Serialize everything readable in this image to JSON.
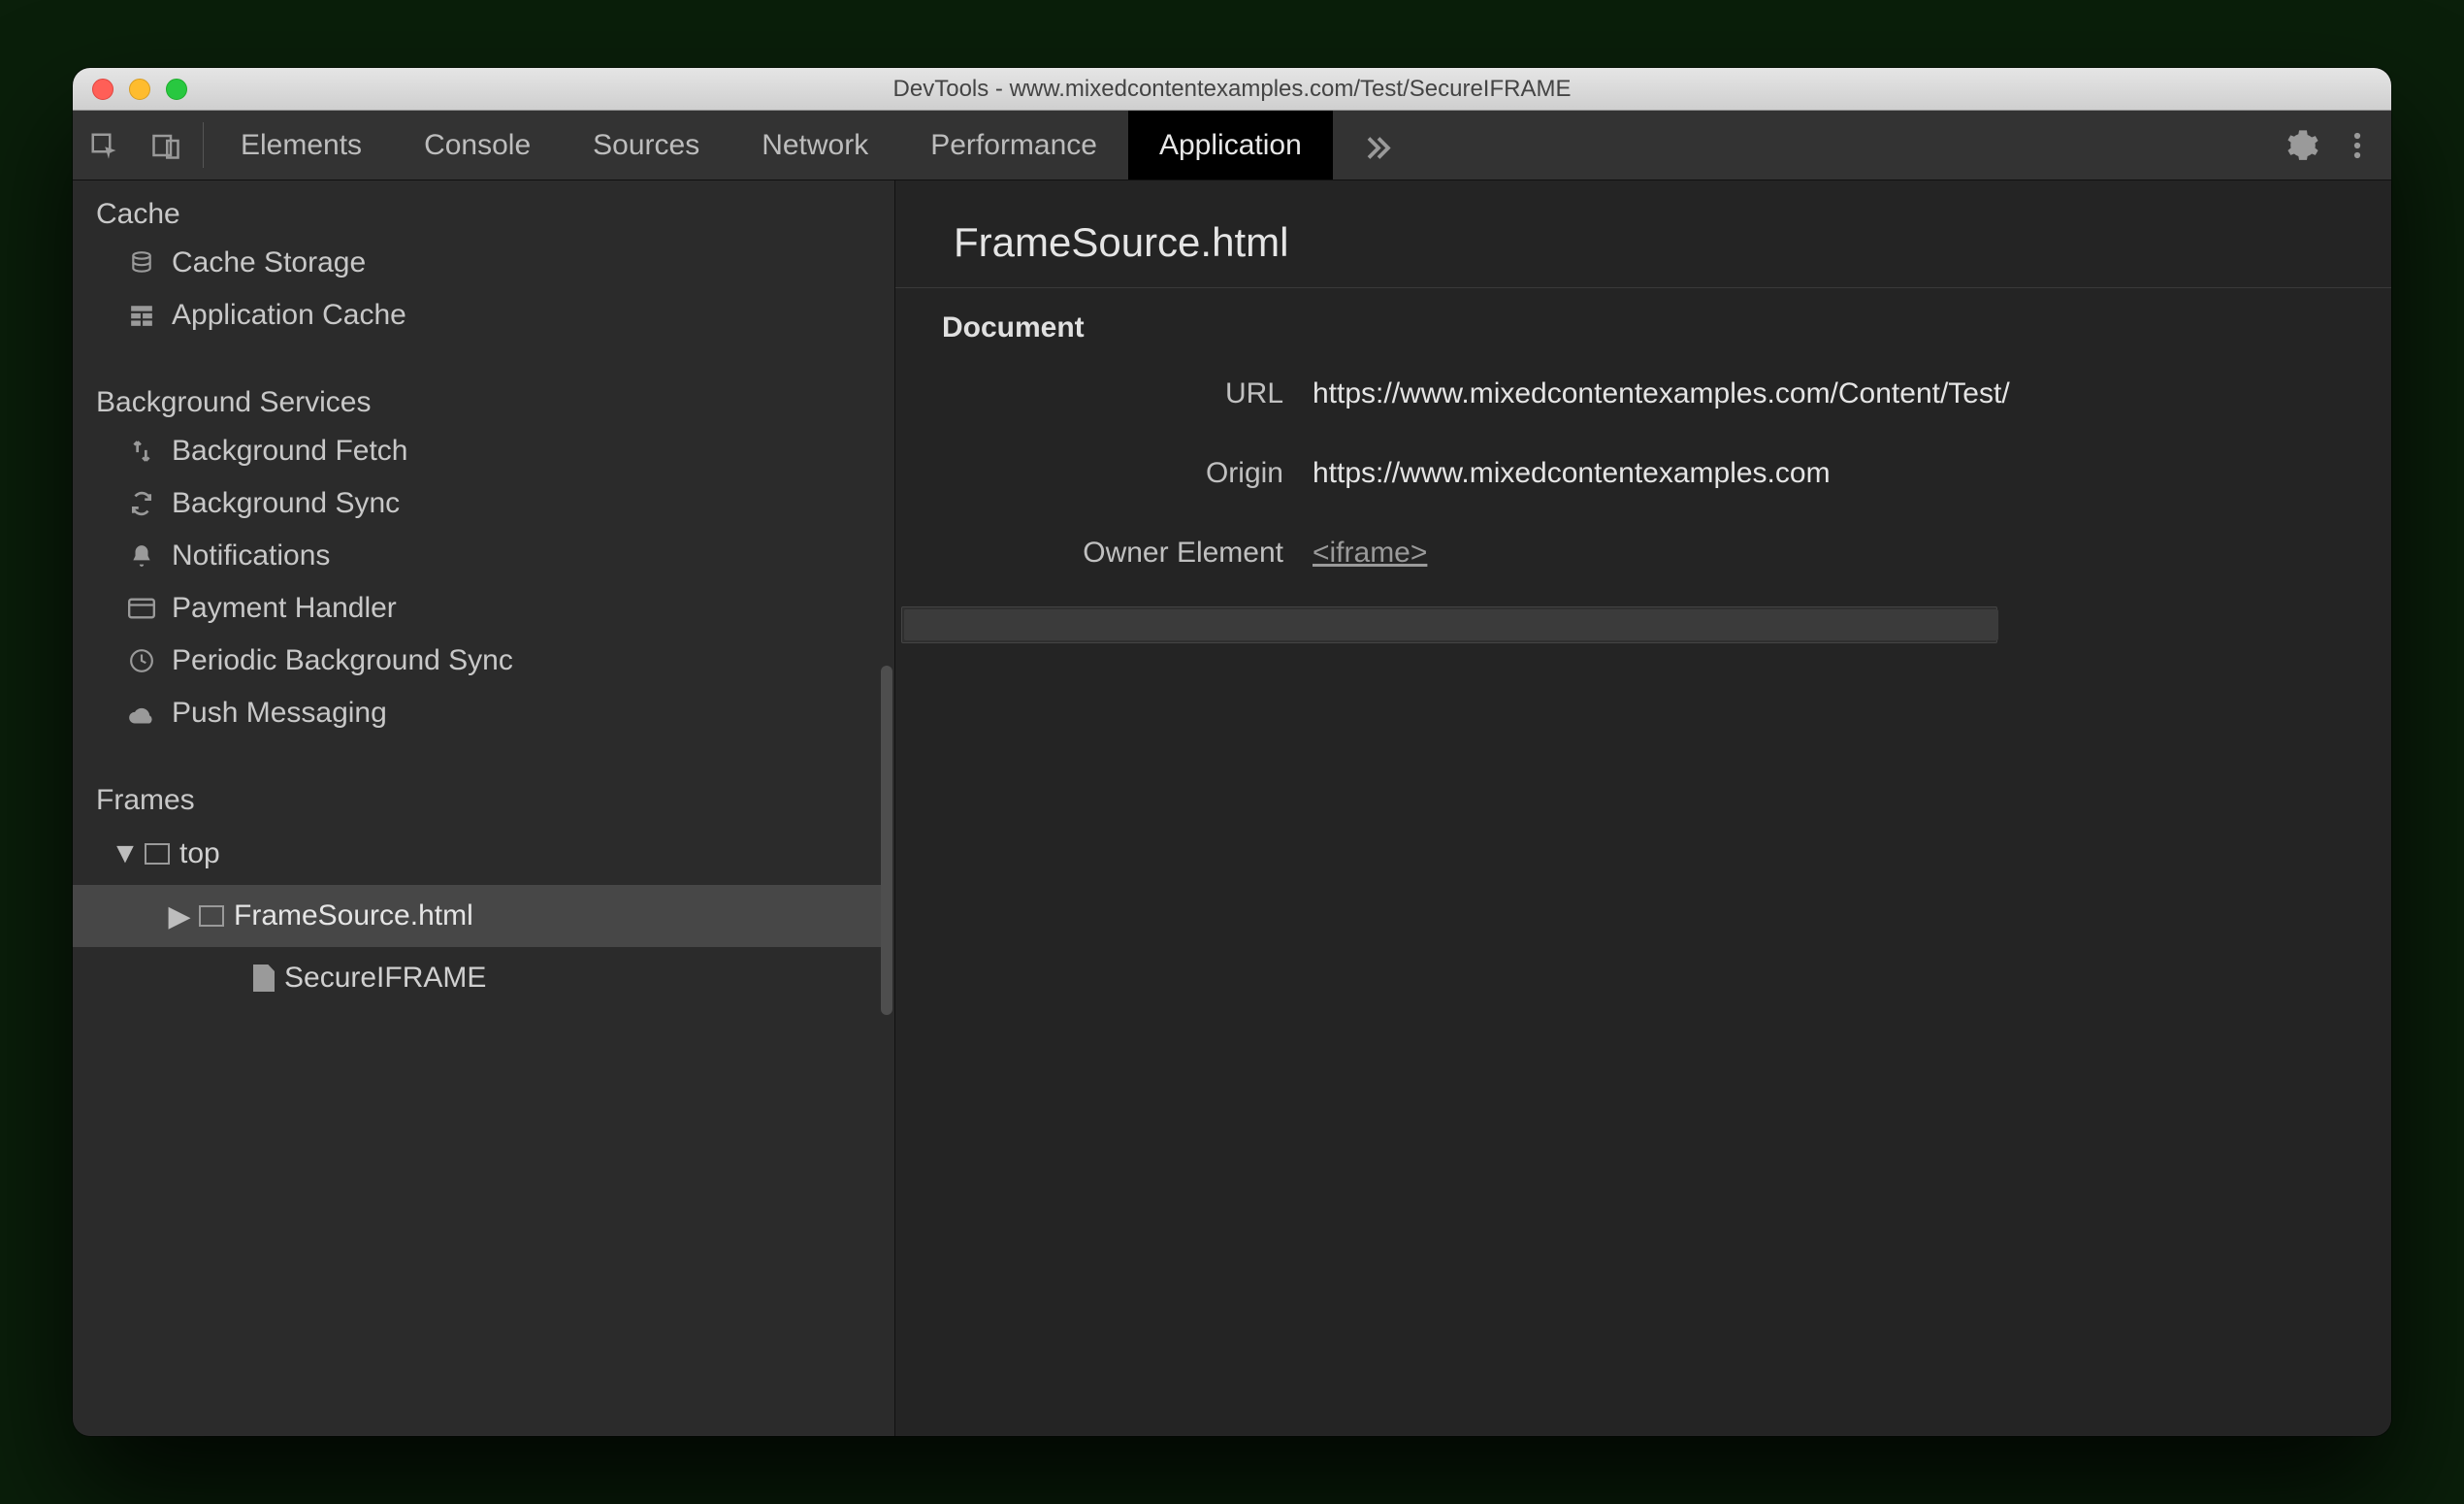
{
  "window_title": "DevTools - www.mixedcontentexamples.com/Test/SecureIFRAME",
  "tabs": {
    "items": [
      "Elements",
      "Console",
      "Sources",
      "Network",
      "Performance",
      "Application"
    ],
    "active": "Application"
  },
  "sidebar": {
    "cache": {
      "label": "Cache",
      "items": [
        "Cache Storage",
        "Application Cache"
      ]
    },
    "bg": {
      "label": "Background Services",
      "items": [
        "Background Fetch",
        "Background Sync",
        "Notifications",
        "Payment Handler",
        "Periodic Background Sync",
        "Push Messaging"
      ]
    },
    "frames": {
      "label": "Frames",
      "top": "top",
      "child1": "FrameSource.html",
      "child2": "SecureIFRAME"
    }
  },
  "detail": {
    "title": "FrameSource.html",
    "section": "Document",
    "url_label": "URL",
    "url_value": "https://www.mixedcontentexamples.com/Content/Test/",
    "origin_label": "Origin",
    "origin_value": "https://www.mixedcontentexamples.com",
    "owner_label": "Owner Element",
    "owner_value": "<iframe>"
  }
}
